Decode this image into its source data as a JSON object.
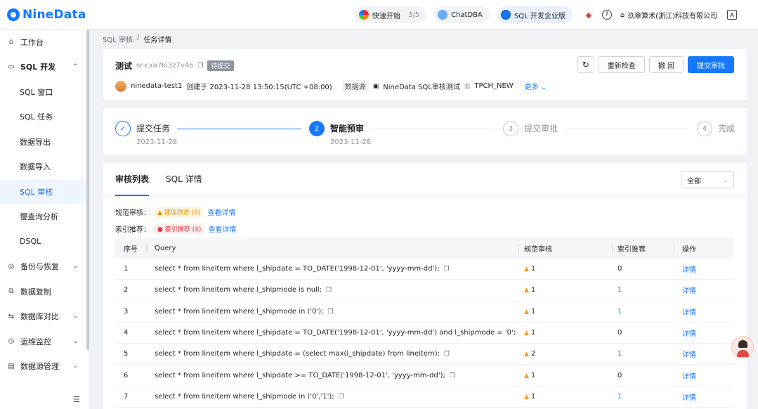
{
  "app": {
    "logo_text": "NineData",
    "brand_color": "#1677ff"
  },
  "topbar": {
    "quickstart_label": "快速开始",
    "quickstart_progress": "3/5",
    "chatdba_label": "ChatDBA",
    "edition_label": "SQL 开发企业版",
    "company_name": "玖章算术(浙江)科技有限公司"
  },
  "sidebar": {
    "items": [
      {
        "label": "工作台",
        "icon": "home-icon"
      },
      {
        "label": "SQL 开发",
        "icon": "sql-icon",
        "expanded": true
      },
      {
        "label": "SQL 窗口"
      },
      {
        "label": "SQL 任务"
      },
      {
        "label": "数据导出"
      },
      {
        "label": "数据导入"
      },
      {
        "label": "SQL 审核",
        "active": true
      },
      {
        "label": "慢查询分析"
      },
      {
        "label": "DSQL"
      },
      {
        "label": "备份与恢复",
        "icon": "backup-icon"
      },
      {
        "label": "数据复制",
        "icon": "replication-icon"
      },
      {
        "label": "数据库对比",
        "icon": "compare-icon"
      },
      {
        "label": "运维监控",
        "icon": "monitor-icon"
      },
      {
        "label": "数据源管理",
        "icon": "datasource-icon"
      }
    ]
  },
  "breadcrumb": {
    "parent": "SQL 审核",
    "separator": "/",
    "current": "任务详情"
  },
  "task": {
    "name": "测试",
    "id": "sr-cxa7ki3z7v46",
    "status": "待提交",
    "creator": "ninedata-test1",
    "created_text": "创建于 2023-11-28 13:50:15(UTC +08:00)",
    "datasource_label": "数据源",
    "datasource_name": "NineData SQL审核测试",
    "database": "TPCH_NEW",
    "more_label": "更多",
    "buttons": {
      "recheck": "重新检查",
      "withdraw": "撤 回",
      "submit": "提交审批"
    }
  },
  "steps": [
    {
      "number": "✓",
      "label": "提交任务",
      "date": "2023-11-28",
      "state": "done"
    },
    {
      "number": "2",
      "label": "智能预审",
      "date": "2023-11-28",
      "state": "current"
    },
    {
      "number": "3",
      "label": "提交审批",
      "date": "",
      "state": "wait"
    },
    {
      "number": "4",
      "label": "完成",
      "date": "",
      "state": "wait"
    }
  ],
  "list": {
    "tabs": [
      "审核列表",
      "SQL 详情"
    ],
    "filter_value": "全部",
    "summary": {
      "standard_label": "规范审核：",
      "standard_tag": "建议改进 (9)",
      "index_label": "索引推荐：",
      "index_tag": "索引推荐 (4)",
      "detail_link": "查看详情"
    },
    "columns": [
      "序号",
      "Query",
      "规范审核",
      "索引推荐",
      "操作"
    ],
    "rows": [
      {
        "no": "1",
        "query": "select * from lineitem where l_shipdate = TO_DATE('1998-12-01', 'yyyy-mm-dd');",
        "std": "1",
        "idx": "0",
        "op": "详情"
      },
      {
        "no": "2",
        "query": "select * from lineitem where l_shipmode is null;",
        "std": "1",
        "idx": "1",
        "op": "详情"
      },
      {
        "no": "3",
        "query": "select * from lineitem where l_shipmode in ('0');",
        "std": "1",
        "idx": "1",
        "op": "详情"
      },
      {
        "no": "4",
        "query": "select * from lineitem where l_shipdate = TO_DATE('1998-12-01', 'yyyy-mm-dd') and l_shipmode = '0';",
        "std": "1",
        "idx": "0",
        "op": "详情"
      },
      {
        "no": "5",
        "query": "select * from lineitem where l_shipdate = (select max(l_shipdate) from lineitem);",
        "std": "2",
        "idx": "1",
        "op": "详情"
      },
      {
        "no": "6",
        "query": "select * from lineitem where l_shipdate >= TO_DATE('1998-12-01', 'yyyy-mm-dd');",
        "std": "1",
        "idx": "0",
        "op": "详情"
      },
      {
        "no": "7",
        "query": "select * from lineitem where l_shipmode in ('0','1');",
        "std": "1",
        "idx": "1",
        "op": "详情"
      }
    ]
  }
}
